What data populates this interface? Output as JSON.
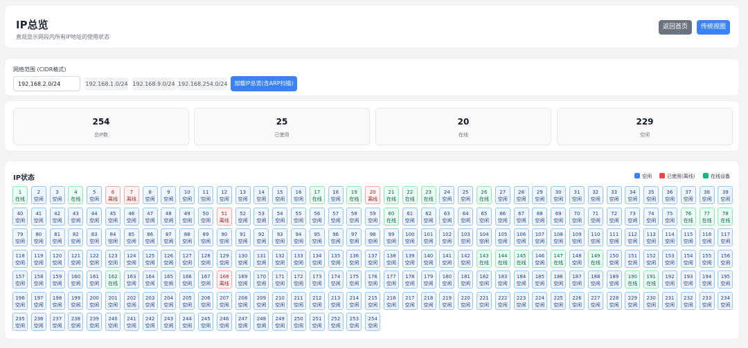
{
  "header": {
    "title": "IP总览",
    "subtitle": "直观显示网段内所有IP地址的使用状态",
    "home_label": "返回首页",
    "legacy_label": "传统视图"
  },
  "cidr": {
    "label": "网络范围 (CIDR格式)",
    "value": "192.168.2.0/24",
    "presets": [
      "192.168.1.0/24",
      "192.168.9.0/24",
      "192.168.254.0/24"
    ],
    "load_label": "加载IP总览(含ARP扫描)"
  },
  "stats": [
    {
      "value": "254",
      "label": "总IP数"
    },
    {
      "value": "25",
      "label": "已使用"
    },
    {
      "value": "20",
      "label": "在线"
    },
    {
      "value": "229",
      "label": "空闲"
    }
  ],
  "grid": {
    "title": "IP状态",
    "legend": {
      "free": "空闲",
      "offline": "已使用(离线)",
      "online": "在线设备"
    },
    "colors": {
      "free": "#3b82f6",
      "offline": "#ef4444",
      "online": "#10b981"
    },
    "status_text": {
      "free": "空闲",
      "offline": "离线",
      "online": "在线"
    },
    "total": 254,
    "per_row": 39,
    "online": [
      1,
      4,
      17,
      19,
      21,
      22,
      23,
      26,
      60,
      76,
      77,
      78,
      143,
      144,
      145,
      147,
      149,
      162,
      190,
      191
    ],
    "offline": [
      6,
      7,
      20,
      51,
      168
    ]
  }
}
